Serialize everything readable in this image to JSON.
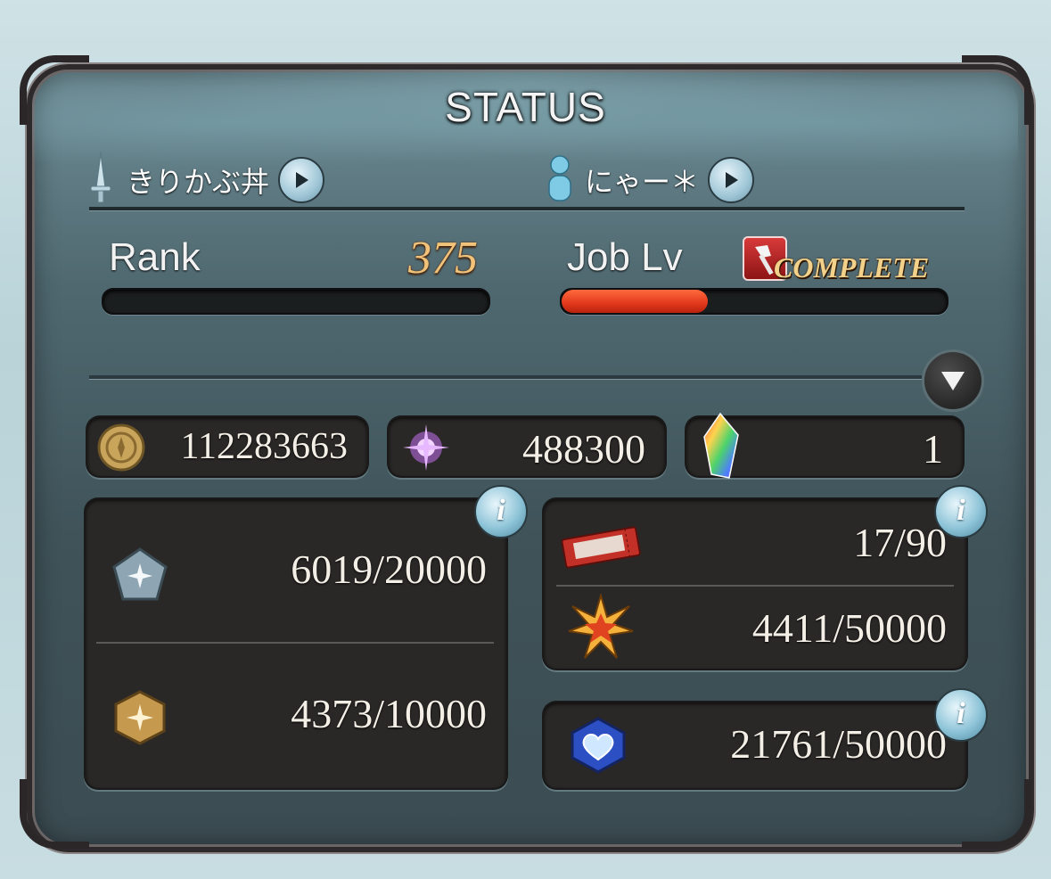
{
  "title": "STATUS",
  "players": [
    {
      "name": "きりかぶ丼",
      "icon": "sword-icon"
    },
    {
      "name": "にゃー＊",
      "icon": "person-icon"
    }
  ],
  "rank": {
    "label": "Rank",
    "value": "375",
    "progress": 0.0
  },
  "job": {
    "label": "Job Lv",
    "status": "COMPLETE",
    "progress": 0.38
  },
  "currencies": {
    "rupie": "112283663",
    "crystals": "488300",
    "rainbow_crystal": "1"
  },
  "pendants": {
    "honor": "6019/20000",
    "renown": "4373/10000"
  },
  "resources": {
    "ticket": "17/90",
    "burst": "4411/50000",
    "heart": "21761/50000"
  },
  "info_label": "i",
  "colors": {
    "accent": "#e1381b",
    "gold": "#f0c27a",
    "panel": "#4f6870"
  }
}
